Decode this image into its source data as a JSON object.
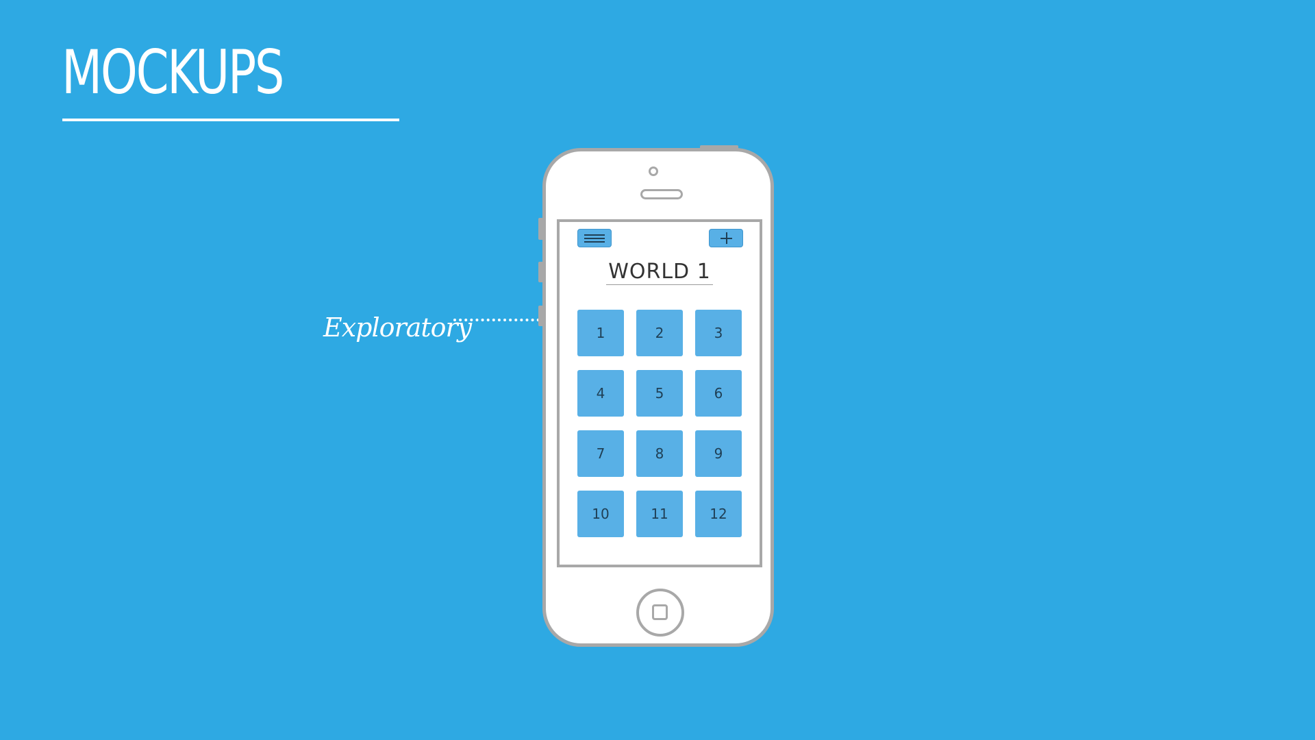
{
  "slide": {
    "title": "MOCKUPS",
    "callout_label": "Exploratory",
    "background_color": "#2ea9e3"
  },
  "app_screen": {
    "menu_icon": "hamburger-menu-icon",
    "add_icon": "plus-icon",
    "world_title": "WORLD 1",
    "levels": [
      "1",
      "2",
      "3",
      "4",
      "5",
      "6",
      "7",
      "8",
      "9",
      "10",
      "11",
      "12"
    ],
    "tile_color": "#58b0e6"
  }
}
